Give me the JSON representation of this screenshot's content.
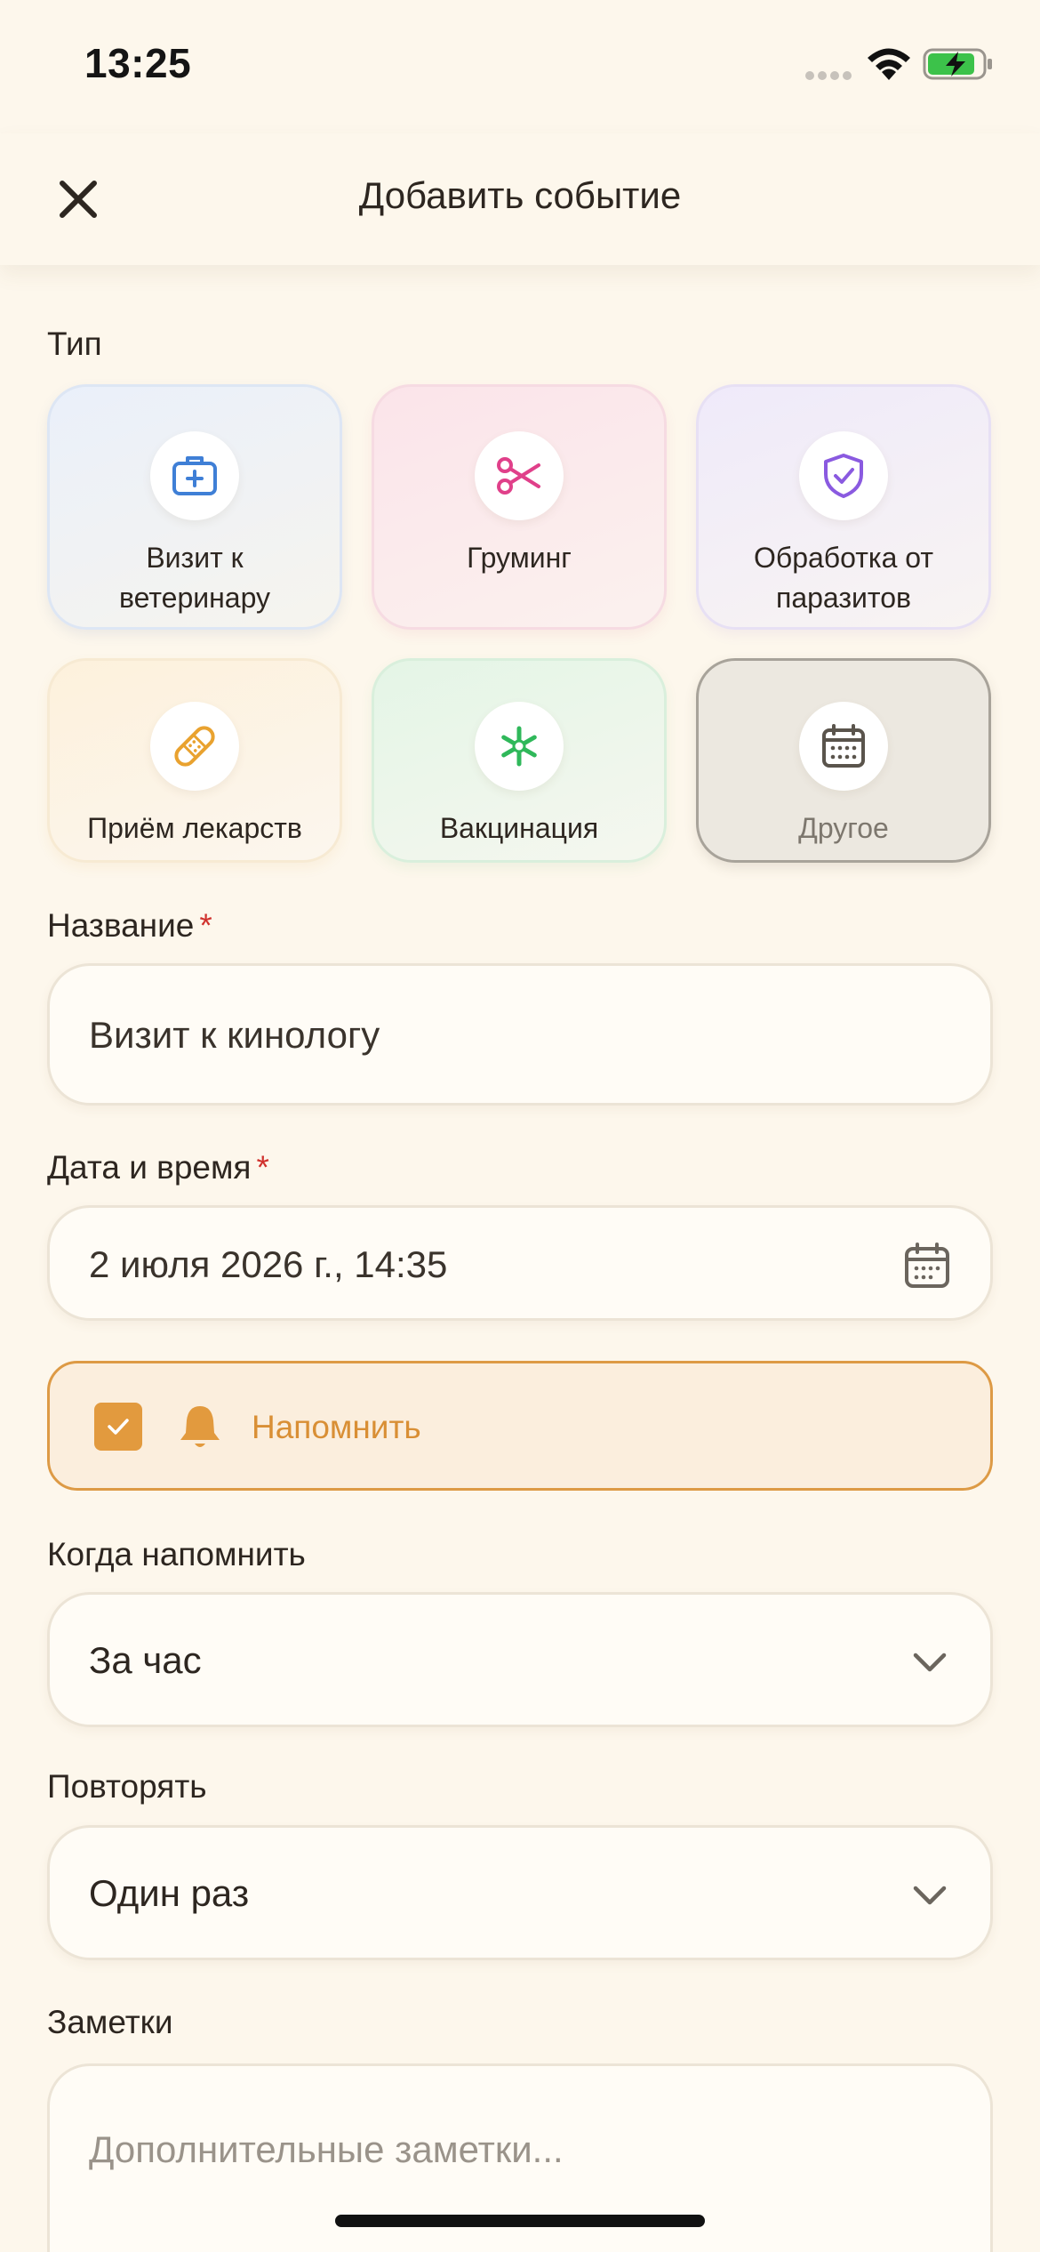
{
  "status_bar": {
    "time": "13:25"
  },
  "header": {
    "title": "Добавить событие"
  },
  "type_section": {
    "label": "Тип",
    "options": [
      {
        "label": "Визит к ветеринару",
        "line1": "Визит к",
        "line2": "ветеринару",
        "icon": "medical-kit-icon",
        "color": "#3f7fd6"
      },
      {
        "label": "Груминг",
        "line1": "Груминг",
        "line2": "",
        "icon": "scissors-icon",
        "color": "#e0408a"
      },
      {
        "label": "Обработка от паразитов",
        "line1": "Обработка от",
        "line2": "паразитов",
        "icon": "shield-check-icon",
        "color": "#8a5ae0"
      },
      {
        "label": "Приём лекарств",
        "line1": "Приём лекарств",
        "line2": "",
        "icon": "bandage-icon",
        "color": "#e9a22f"
      },
      {
        "label": "Вакцинация",
        "line1": "Вакцинация",
        "line2": "",
        "icon": "asterisk-icon",
        "color": "#2fb85a"
      },
      {
        "label": "Другое",
        "line1": "Другое",
        "line2": "",
        "icon": "calendar-icon",
        "color": "#6b655d",
        "selected": true
      }
    ]
  },
  "title_field": {
    "label": "Название",
    "required_mark": "*",
    "value": "Визит к кинологу"
  },
  "date_field": {
    "label": "Дата и время",
    "required_mark": "*",
    "value": "2 июля 2026 г., 14:35"
  },
  "reminder": {
    "label": "Напомнить",
    "checked": true,
    "accent": "#e29a3e"
  },
  "remind_when": {
    "label": "Когда напомнить",
    "value": "За час"
  },
  "repeat": {
    "label": "Повторять",
    "value": "Один раз"
  },
  "notes": {
    "label": "Заметки",
    "placeholder": "Дополнительные заметки..."
  }
}
